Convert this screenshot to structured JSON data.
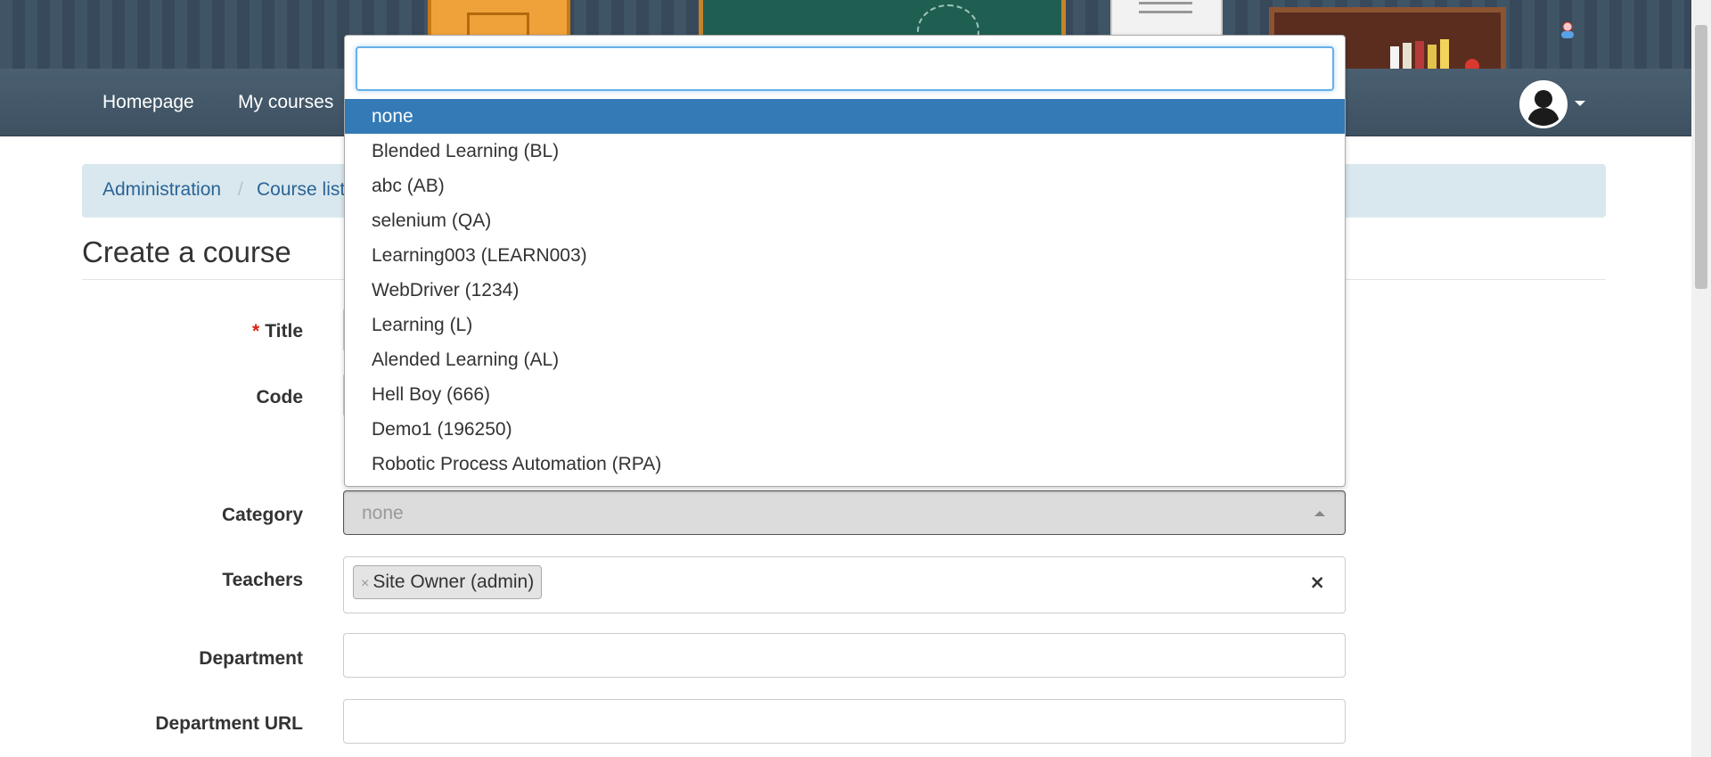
{
  "nav": {
    "homepage": "Homepage",
    "my_courses": "My courses"
  },
  "breadcrumb": {
    "item1": "Administration",
    "separator": "/",
    "item2": "Course list"
  },
  "page_title": "Create a course",
  "form": {
    "title_required_mark": "*",
    "title_label": "Title",
    "code_label": "Code",
    "category_label": "Category",
    "category_value": "none",
    "teachers_label": "Teachers",
    "teacher_tag": "Site Owner (admin)",
    "tag_remove": "×",
    "teachers_clear": "×",
    "department_label": "Department",
    "department_url_label": "Department URL"
  },
  "dropdown": {
    "search_value": "",
    "options": [
      "none",
      "Blended Learning (BL)",
      "abc (AB)",
      "selenium (QA)",
      "Learning003 (LEARN003)",
      "WebDriver (1234)",
      "Learning (L)",
      "Alended Learning (AL)",
      "Hell Boy (666)",
      "Demo1 (196250)",
      "Robotic Process Automation (RPA)"
    ],
    "selected_index": 0
  },
  "icons": {
    "user_mini": "user-icon",
    "avatar": "user-avatar-icon",
    "caret": "chevron-down-icon"
  },
  "colors": {
    "navbar": "#455a6b",
    "selected_option": "#337ab7",
    "breadcrumb_bg": "#d9e8ee",
    "link": "#2a6496",
    "required": "#d9230f"
  }
}
